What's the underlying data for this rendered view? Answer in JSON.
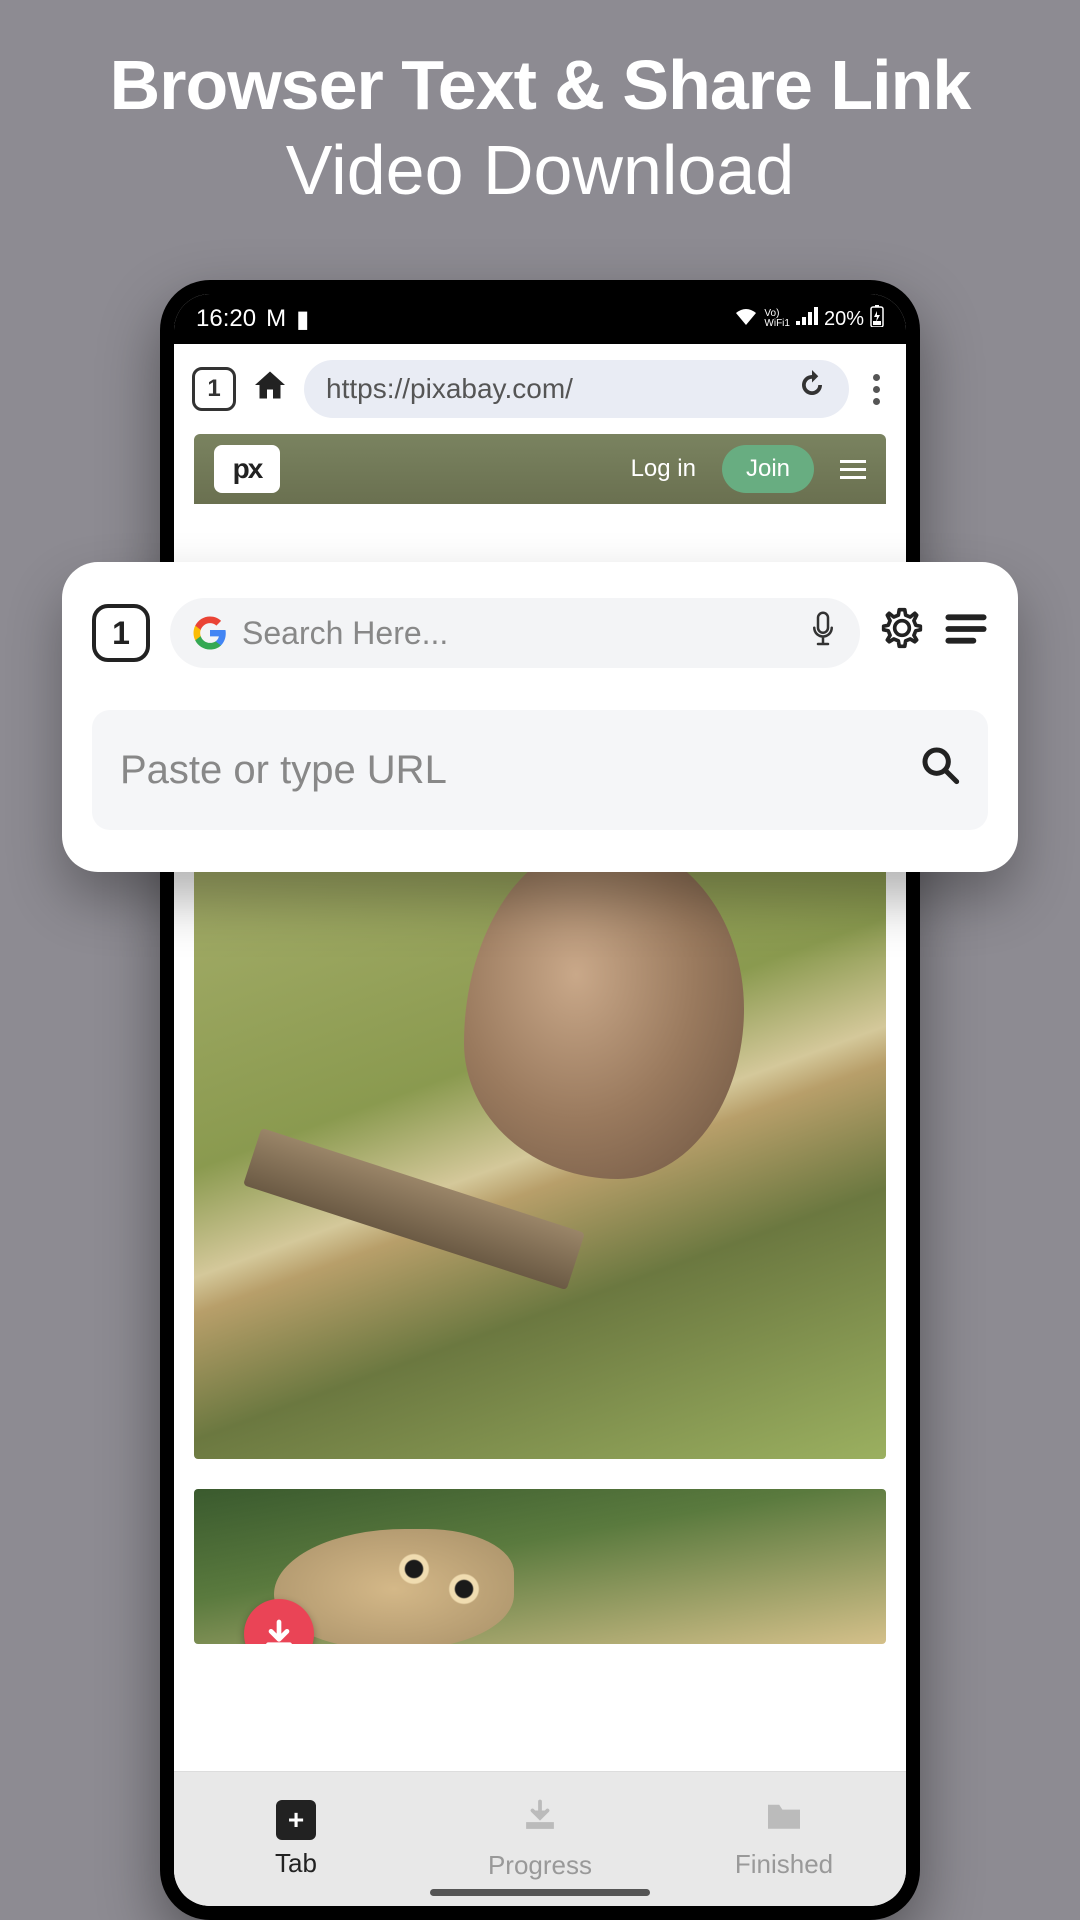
{
  "headline": {
    "bold": "Browser Text & Share Link",
    "light": "Video Download"
  },
  "statusbar": {
    "time": "16:20",
    "battery": "20%"
  },
  "browser": {
    "tab_count": "1",
    "url": "https://pixabay.com/"
  },
  "pixabay": {
    "logo": "px",
    "login": "Log in",
    "join": "Join"
  },
  "overlay": {
    "tab_count": "1",
    "search_placeholder": "Search Here...",
    "url_placeholder": "Paste or type URL"
  },
  "bottom_nav": {
    "tab_label": "Tab",
    "tab_plus": "+",
    "progress_label": "Progress",
    "finished_label": "Finished"
  }
}
